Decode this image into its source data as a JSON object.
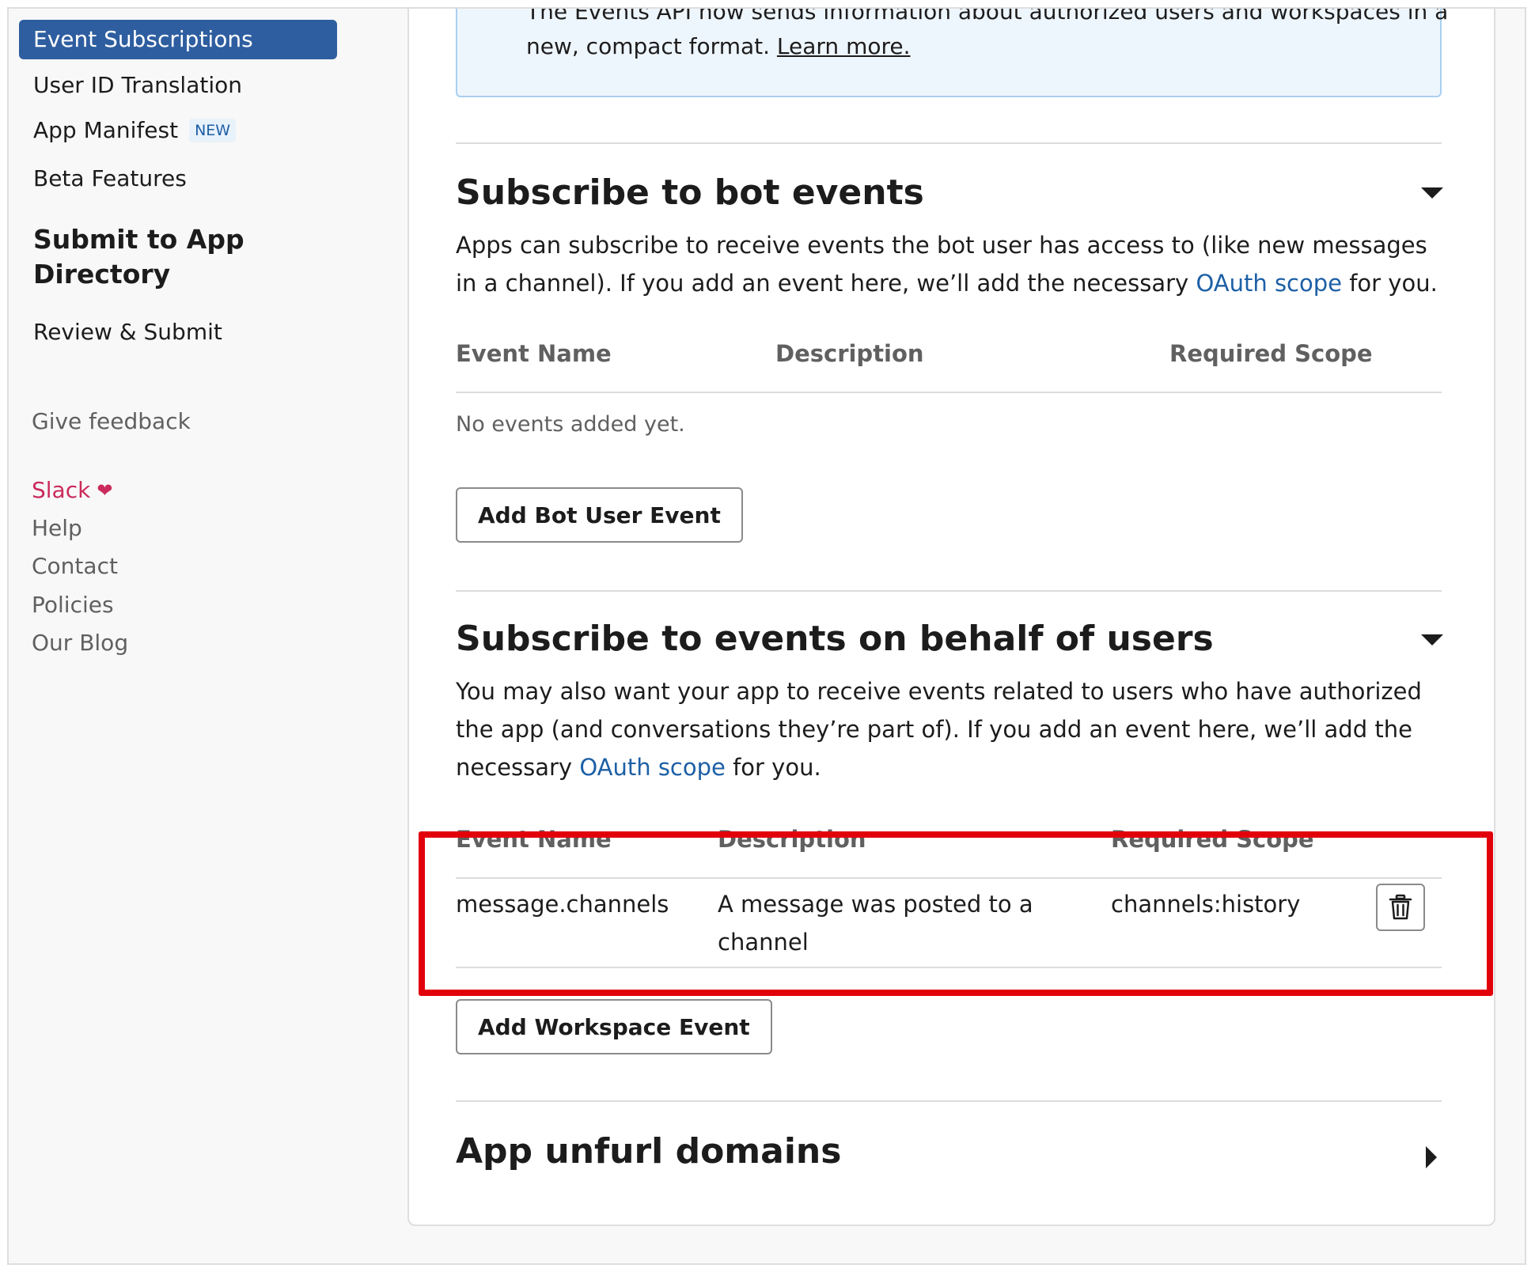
{
  "sidebar": {
    "active_item": "Event Subscriptions",
    "items": [
      {
        "label": "User ID Translation"
      },
      {
        "label": "App Manifest",
        "badge": "NEW"
      },
      {
        "label": "Beta Features"
      }
    ],
    "submit_heading": "Submit to App Directory",
    "review_submit": "Review & Submit",
    "give_feedback": "Give feedback",
    "footer_links": {
      "slack": "Slack",
      "help": "Help",
      "contact": "Contact",
      "policies": "Policies",
      "blog": "Our Blog"
    }
  },
  "notice": {
    "text": "The Events API now sends information about authorized users and workspaces in a new, compact format.",
    "link": "Learn more."
  },
  "bot_events": {
    "title": "Subscribe to bot events",
    "desc_before": "Apps can subscribe to receive events the bot user has access to (like new messages in a channel). If you add an event here, we’ll add the necessary",
    "desc_link": "OAuth scope",
    "desc_after": "for you.",
    "columns": [
      "Event Name",
      "Description",
      "Required Scope"
    ],
    "empty_text": "No events added yet.",
    "add_button": "Add Bot User Event"
  },
  "user_events": {
    "title": "Subscribe to events on behalf of users",
    "desc_before": "You may also want your app to receive events related to users who have authorized the app (and conversations they’re part of). If you add an event here, we’ll add the necessary",
    "desc_link": "OAuth scope",
    "desc_after": "for you.",
    "columns": [
      "Event Name",
      "Description",
      "Required Scope"
    ],
    "rows": [
      {
        "event": "message.channels",
        "description": "A message was posted to a channel",
        "scope": "channels:history"
      }
    ],
    "add_button": "Add Workspace Event"
  },
  "unfurl": {
    "title": "App unfurl domains"
  },
  "colors": {
    "accent": "#2e5ea0",
    "link": "#1d5fa6",
    "highlight": "#e2000b",
    "slack_pink": "#cb2b5c"
  }
}
